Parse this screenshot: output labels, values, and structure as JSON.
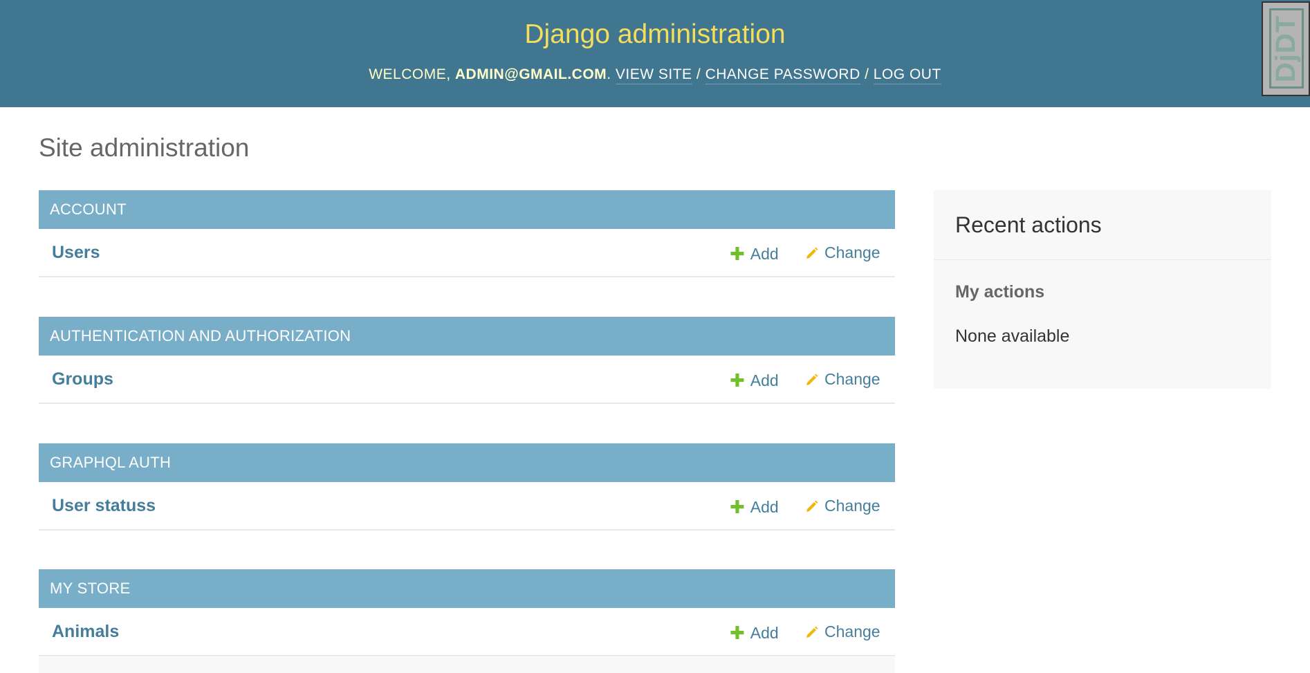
{
  "header": {
    "branding": "Django administration",
    "welcome_prefix": "WELCOME,",
    "username": "ADMIN@GMAIL.COM",
    "welcome_suffix": ".",
    "view_site": "VIEW SITE",
    "separator": "/",
    "change_password": "CHANGE PASSWORD",
    "log_out": "LOG OUT"
  },
  "debug_toolbar": {
    "handle_label": "DjDT"
  },
  "page_title": "Site administration",
  "modules": [
    {
      "caption": "ACCOUNT",
      "models": [
        {
          "name": "Users",
          "add": "Add",
          "change": "Change"
        }
      ]
    },
    {
      "caption": "AUTHENTICATION AND AUTHORIZATION",
      "models": [
        {
          "name": "Groups",
          "add": "Add",
          "change": "Change"
        }
      ]
    },
    {
      "caption": "GRAPHQL AUTH",
      "models": [
        {
          "name": "User statuss",
          "add": "Add",
          "change": "Change"
        }
      ]
    },
    {
      "caption": "MY STORE",
      "models": [
        {
          "name": "Animals",
          "add": "Add",
          "change": "Change"
        }
      ]
    }
  ],
  "recent_actions": {
    "title": "Recent actions",
    "my_actions": "My actions",
    "empty_text": "None available"
  },
  "colors": {
    "header_bg": "#417690",
    "branding": "#f5dd5d",
    "module_caption_bg": "#79aec8",
    "link": "#447e9b",
    "add_icon": "#70bf2b",
    "change_icon": "#efb80b"
  },
  "icons": {
    "add": "plus-icon",
    "change": "pencil-icon"
  }
}
